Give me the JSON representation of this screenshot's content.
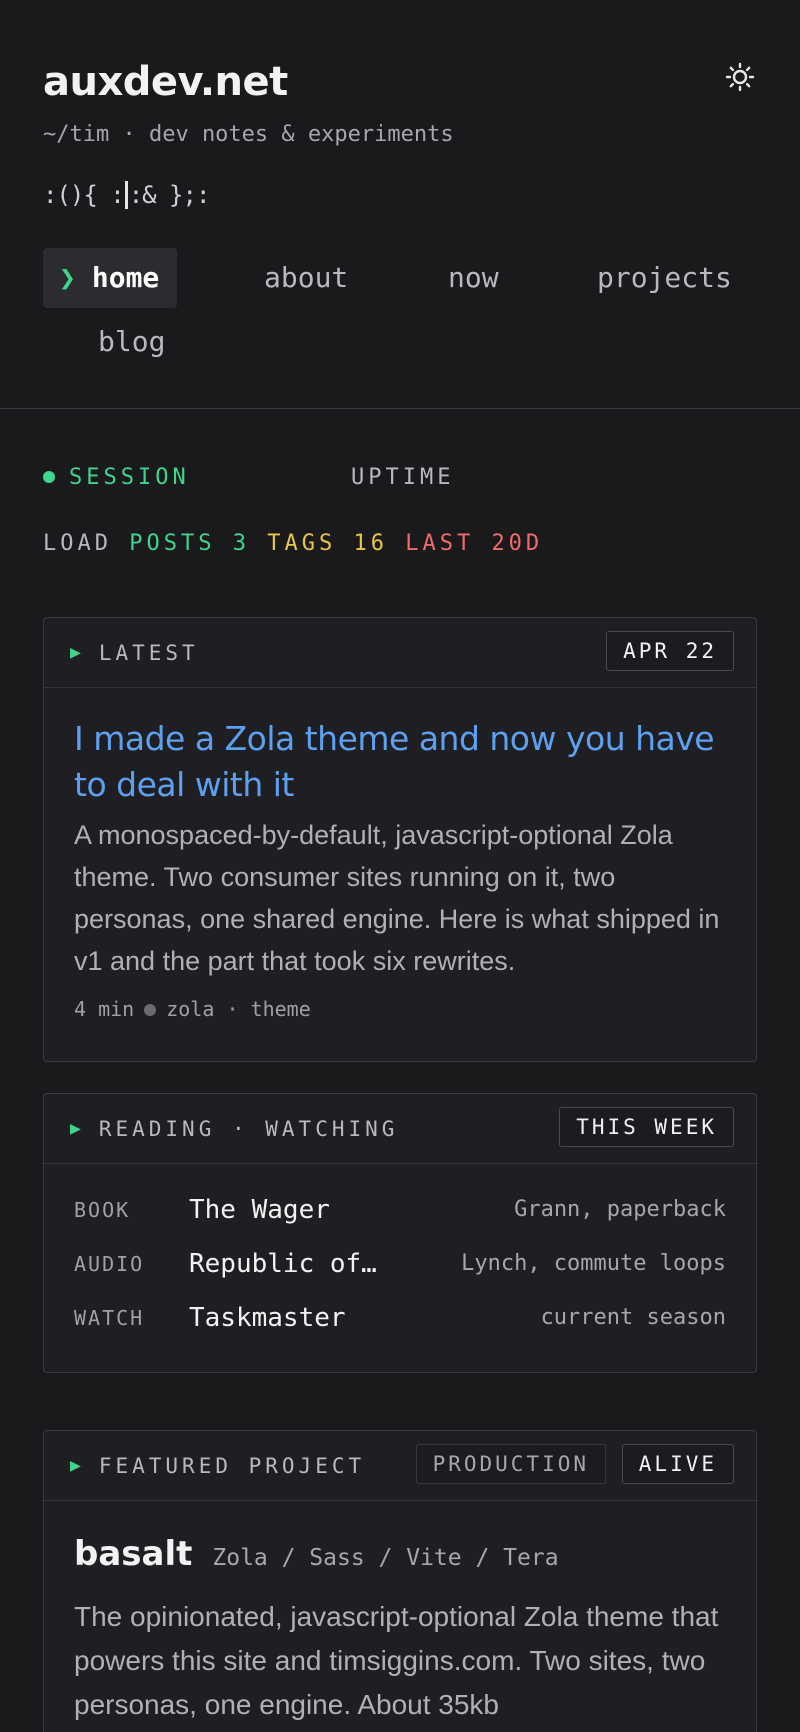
{
  "site": {
    "title": "auxdev.net",
    "tagline": "~/tim · dev notes & experiments",
    "forkbomb_left": ":(){ :",
    "forkbomb_right": ":& };:"
  },
  "nav": {
    "items": [
      {
        "label": "home",
        "active": true
      },
      {
        "label": "about"
      },
      {
        "label": "now"
      },
      {
        "label": "projects"
      },
      {
        "label": "blog"
      }
    ],
    "active_marker": "❯"
  },
  "stats": {
    "session_label": "SESSION",
    "uptime_label": "UPTIME",
    "load_label": "LOAD",
    "posts_label": "POSTS",
    "posts_value": "3",
    "tags_label": "TAGS",
    "tags_value": "16",
    "last_label": "LAST",
    "last_value": "20D"
  },
  "latest": {
    "label": "LATEST",
    "date": "APR 22",
    "title": "I made a Zola theme and now you have to deal with it",
    "description": "A monospaced-by-default, javascript-optional Zola theme. Two consumer sites running on it, two personas, one shared engine. Here is what shipped in v1 and the part that took six rewrites.",
    "read_time": "4 min",
    "tag1": "zola",
    "separator": "·",
    "tag2": "theme"
  },
  "reading": {
    "label": "READING · WATCHING",
    "badge": "THIS WEEK",
    "items": [
      {
        "kind": "BOOK",
        "title": "The Wager",
        "note": "Grann, paperback"
      },
      {
        "kind": "AUDIO",
        "title": "Republic of…",
        "note": "Lynch, commute loops"
      },
      {
        "kind": "WATCH",
        "title": "Taskmaster",
        "note": "current season"
      }
    ]
  },
  "project": {
    "label": "FEATURED PROJECT",
    "badge_status": "PRODUCTION",
    "badge_state": "ALIVE",
    "name": "basalt",
    "stack": "Zola / Sass / Vite / Tera",
    "description": "The opinionated, javascript-optional Zola theme that powers this site and timsiggins.com. Two sites, two personas, one engine. About 35kb"
  },
  "colors": {
    "accent_green": "#3dd68c",
    "accent_yellow": "#e7c547",
    "accent_red": "#f26b6b",
    "link_blue": "#5ea0f0",
    "background": "#1a1a1d"
  },
  "icons": {
    "theme_toggle": "sun-icon"
  }
}
